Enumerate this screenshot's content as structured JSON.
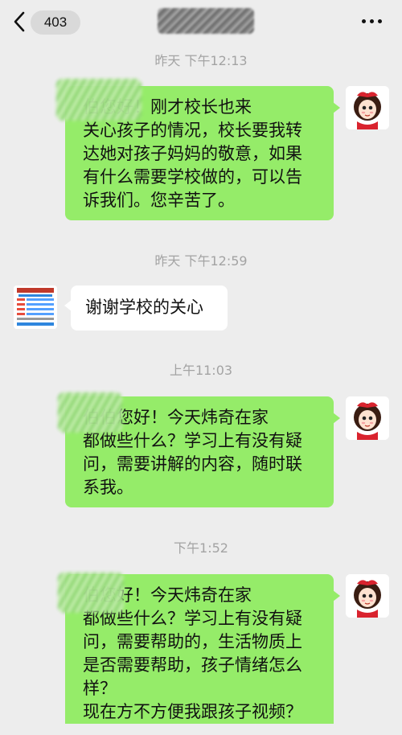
{
  "header": {
    "unread_count": "403",
    "back_icon": "chevron-left-icon",
    "more_icon": "more-dots-icon"
  },
  "messages": [
    {
      "type": "timestamp",
      "text": "昨天 下午12:13"
    },
    {
      "type": "out",
      "text": "伯您好！刚才校长也来\n关心孩子的情况，校长要我转\n达她对孩子妈妈的敬意，如果\n有什么需要学校做的，可以告\n诉我们。您辛苦了。"
    },
    {
      "type": "timestamp",
      "text": "昨天 下午12:59"
    },
    {
      "type": "in",
      "text": "谢谢学校的关心"
    },
    {
      "type": "timestamp",
      "text": "上午11:03"
    },
    {
      "type": "out",
      "text": "伯伯您好！今天炜奇在家\n都做些什么？学习上有没有疑\n问，需要讲解的内容，随时联\n系我。"
    },
    {
      "type": "timestamp",
      "text": "下午1:52"
    },
    {
      "type": "out",
      "text": "伯您好！今天炜奇在家\n都做些什么？学习上有没有疑\n问，需要帮助的，生活物质上\n是否需要帮助，孩子情绪怎么\n样？\n现在方不方便我跟孩子视频？\n收到麻烦回复，谢谢"
    }
  ],
  "colors": {
    "background": "#ededed",
    "outgoing_bubble": "#95ec69",
    "incoming_bubble": "#ffffff",
    "timestamp_text": "#a3a3a3"
  }
}
